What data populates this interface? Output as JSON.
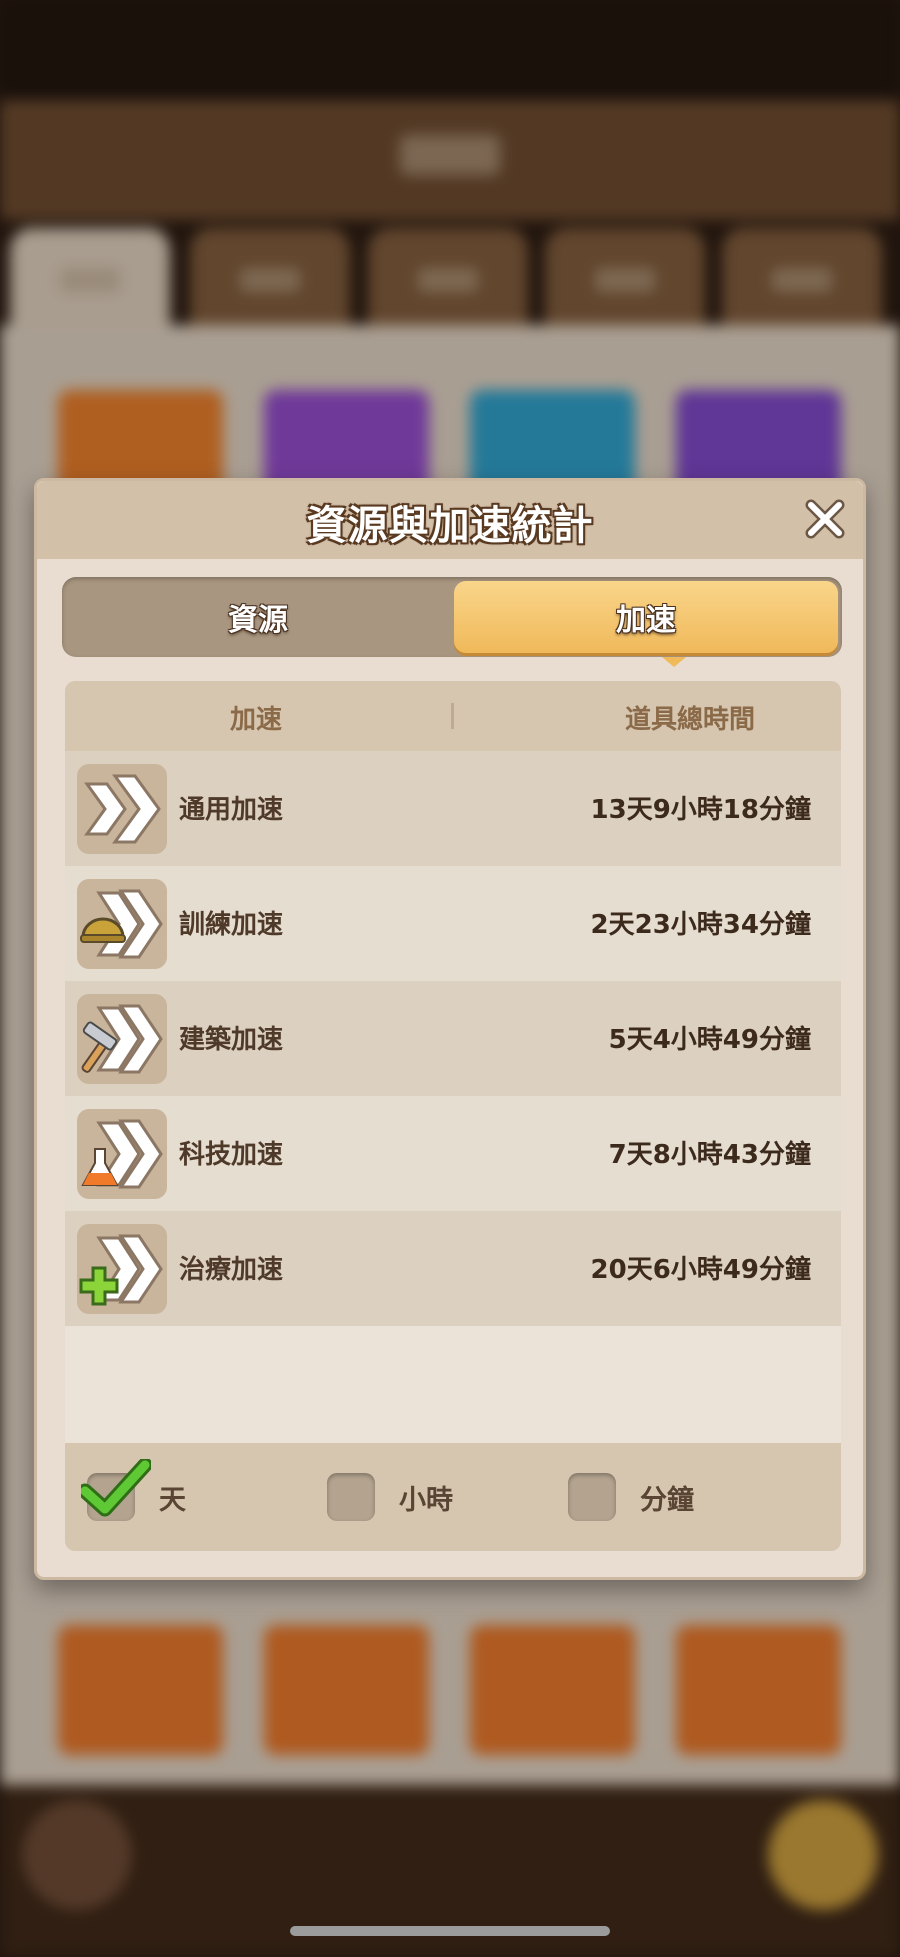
{
  "dialog": {
    "title": "資源與加速統計",
    "close_icon": "close-icon",
    "tabs": [
      {
        "label": "資源",
        "active": false
      },
      {
        "label": "加速",
        "active": true
      }
    ]
  },
  "table": {
    "headers": [
      "加速",
      "道具總時間"
    ],
    "rows": [
      {
        "icon": "general-speedup-icon",
        "name": "通用加速",
        "time": "13天9小時18分鐘"
      },
      {
        "icon": "training-speedup-icon",
        "name": "訓練加速",
        "time": "2天23小時34分鐘"
      },
      {
        "icon": "building-speedup-icon",
        "name": "建築加速",
        "time": "5天4小時49分鐘"
      },
      {
        "icon": "research-speedup-icon",
        "name": "科技加速",
        "time": "7天8小時43分鐘"
      },
      {
        "icon": "healing-speedup-icon",
        "name": "治療加速",
        "time": "20天6小時49分鐘"
      }
    ]
  },
  "units": [
    {
      "label": "天",
      "checked": true
    },
    {
      "label": "小時",
      "checked": false
    },
    {
      "label": "分鐘",
      "checked": false
    }
  ],
  "colors": {
    "accent_tab": "#f0b95a",
    "check_green": "#4caf2a",
    "text_dark": "#3c2a1d"
  }
}
